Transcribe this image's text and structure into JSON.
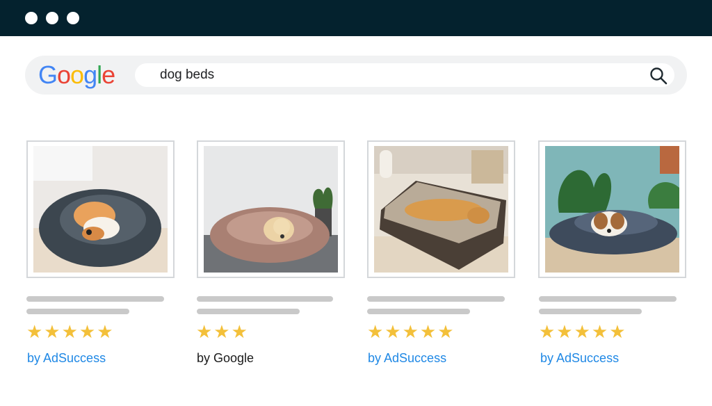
{
  "window": {
    "controls": [
      "close-dot",
      "minimize-dot",
      "maximize-dot"
    ]
  },
  "search": {
    "logo_letters": [
      {
        "char": "G",
        "color": "#4285F4"
      },
      {
        "char": "o",
        "color": "#EA4335"
      },
      {
        "char": "o",
        "color": "#FBBC05"
      },
      {
        "char": "g",
        "color": "#4285F4"
      },
      {
        "char": "l",
        "color": "#34A853"
      },
      {
        "char": "e",
        "color": "#EA4335"
      }
    ],
    "query": "dog beds",
    "icon": "search-icon"
  },
  "results": [
    {
      "image": "dog sleeping in grey plush donut bed",
      "rating": 5,
      "stars": "★★★★★",
      "seller": "by AdSuccess",
      "sponsored": true
    },
    {
      "image": "dog resting in pink plush donut bed",
      "rating": 3,
      "stars": "★★★",
      "seller": "by Google",
      "sponsored": false
    },
    {
      "image": "dog lying on orthopedic rectangular bed",
      "rating": 5,
      "stars": "★★★★★",
      "seller": "by AdSuccess",
      "sponsored": true
    },
    {
      "image": "dog in grey plush bed near plants",
      "rating": 5,
      "stars": "★★★★★",
      "seller": "by AdSuccess",
      "sponsored": true
    }
  ],
  "colors": {
    "titlebar": "#04222e",
    "star": "#f3c03a",
    "sponsored_link": "#1f88e5"
  }
}
